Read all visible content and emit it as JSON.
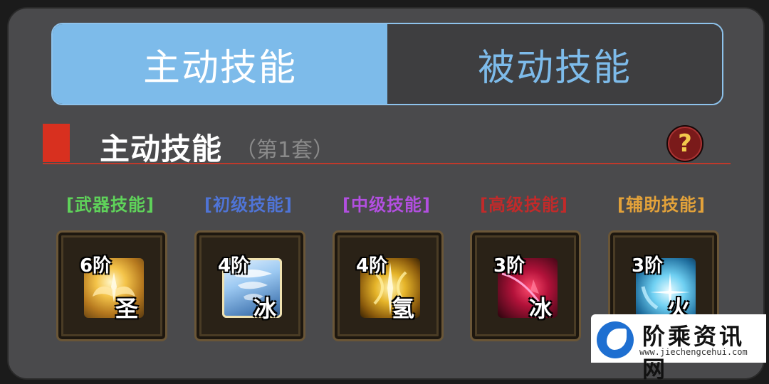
{
  "tabs": [
    {
      "label": "主动技能",
      "active": true
    },
    {
      "label": "被动技能",
      "active": false
    }
  ],
  "section": {
    "title": "主动技能",
    "subtitle": "（第1套）",
    "help_label": "?"
  },
  "categories": [
    {
      "label": "[武器技能]",
      "color": "#5fd35a"
    },
    {
      "label": "[初级技能]",
      "color": "#4f74d6"
    },
    {
      "label": "[中级技能]",
      "color": "#b24fe0"
    },
    {
      "label": "[高级技能]",
      "color": "#c22a2a"
    },
    {
      "label": "[辅助技能]",
      "color": "#e3a23a"
    }
  ],
  "skills": [
    {
      "level": "6阶",
      "element": "圣",
      "icon": "holy-wings-icon"
    },
    {
      "level": "4阶",
      "element": "冰",
      "icon": "ice-tornado-icon"
    },
    {
      "level": "4阶",
      "element": "氢",
      "icon": "golden-burst-icon"
    },
    {
      "level": "3阶",
      "element": "冰",
      "icon": "crimson-slash-icon"
    },
    {
      "level": "3阶",
      "element": "火",
      "icon": "blue-spark-icon"
    }
  ],
  "watermark": {
    "title": "阶乘资讯网",
    "url": "www.jiechengcehui.com"
  }
}
